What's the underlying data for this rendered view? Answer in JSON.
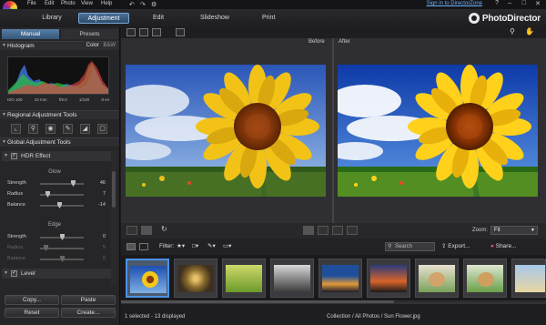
{
  "menu": {
    "file": "File",
    "edit": "Edit",
    "photo": "Photo",
    "view": "View",
    "help": "Help",
    "signin": "Sign in to DirectorZone"
  },
  "top_tabs": [
    "Library",
    "Adjustment",
    "Edit",
    "Slideshow",
    "Print"
  ],
  "active_tab": "Adjustment",
  "app_name": "PhotoDirector",
  "left": {
    "mode_tabs": [
      "Manual",
      "Presets"
    ],
    "histogram": {
      "title": "Histogram",
      "color": "Color",
      "bw": "B&W",
      "info": [
        "ISO 100",
        "10 mm",
        "f/9.0",
        "1/100",
        "0 ev"
      ]
    },
    "regional_title": "Regional Adjustment Tools",
    "global_title": "Global Adjustment Tools",
    "hdr": {
      "label": "HDR Effect",
      "glow_label": "Glow",
      "glow": [
        {
          "name": "Strength",
          "value": "46"
        },
        {
          "name": "Radius",
          "value": "7"
        },
        {
          "name": "Balance",
          "value": "-14"
        }
      ],
      "edge_label": "Edge",
      "edge": [
        {
          "name": "Strength",
          "value": "0"
        },
        {
          "name": "Radius",
          "value": "5"
        },
        {
          "name": "Balance",
          "value": "0"
        }
      ]
    },
    "level_label": "Level",
    "buttons": {
      "copy": "Copy...",
      "paste": "Paste",
      "reset": "Reset",
      "create": "Create..."
    }
  },
  "viewer": {
    "before": "Before",
    "after": "After",
    "zoom_label": "Zoom:",
    "zoom_value": "Fit"
  },
  "filmstrip_toolbar": {
    "filter": "Filter:",
    "search_placeholder": "Search",
    "export": "Export...",
    "share": "Share..."
  },
  "status": {
    "selection": "1 selected - 13 displayed",
    "path": "Collection / All Photos / Sun Flower.jpg"
  },
  "colors": {
    "accent": "#4a93e8",
    "active_tab": "#3a5f86",
    "link": "#6cb0ff"
  }
}
